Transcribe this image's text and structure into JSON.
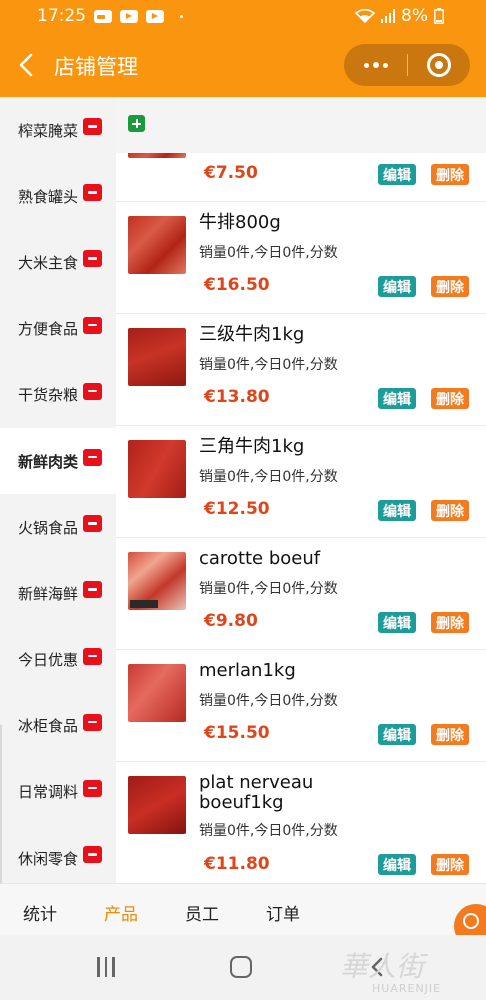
{
  "status_bar": {
    "time": "17:25",
    "battery": "8%"
  },
  "header": {
    "title": "店铺管理"
  },
  "sidebar": {
    "items": [
      {
        "label": "榨菜腌菜"
      },
      {
        "label": "熟食罐头"
      },
      {
        "label": "大米主食"
      },
      {
        "label": "方便食品"
      },
      {
        "label": "干货杂粮"
      },
      {
        "label": "新鲜肉类",
        "active": true
      },
      {
        "label": "火锅食品"
      },
      {
        "label": "新鲜海鲜"
      },
      {
        "label": "今日优惠"
      },
      {
        "label": "冰柜食品"
      },
      {
        "label": "日常调料"
      },
      {
        "label": "休闲零食"
      }
    ]
  },
  "products": [
    {
      "name": "",
      "meta": "",
      "price": "€7.50"
    },
    {
      "name": "牛排800g",
      "meta": "销量0件,今日0件,分数",
      "price": "€16.50"
    },
    {
      "name": "三级牛肉1kg",
      "meta": "销量0件,今日0件,分数",
      "price": "€13.80"
    },
    {
      "name": "三角牛肉1kg",
      "meta": "销量0件,今日0件,分数",
      "price": "€12.50"
    },
    {
      "name": "carotte boeuf",
      "meta": "销量0件,今日0件,分数",
      "price": "€9.80"
    },
    {
      "name": "merlan1kg",
      "meta": "销量0件,今日0件,分数",
      "price": "€15.50"
    },
    {
      "name": "plat nerveau boeuf1kg",
      "meta": "销量0件,今日0件,分数",
      "price": "€11.80"
    }
  ],
  "buttons": {
    "edit": "编辑",
    "delete": "删除"
  },
  "tabs": [
    {
      "label": "统计"
    },
    {
      "label": "产品",
      "active": true
    },
    {
      "label": "员工"
    },
    {
      "label": "订单"
    }
  ],
  "watermark": {
    "main": "華人街",
    "sub": "HUARENJIE"
  },
  "colors": {
    "accent": "#f9950f",
    "price": "#e0451a",
    "edit": "#1e9c99",
    "delete": "#f47a20",
    "minus": "#e8101b",
    "add": "#1a9a3a"
  }
}
